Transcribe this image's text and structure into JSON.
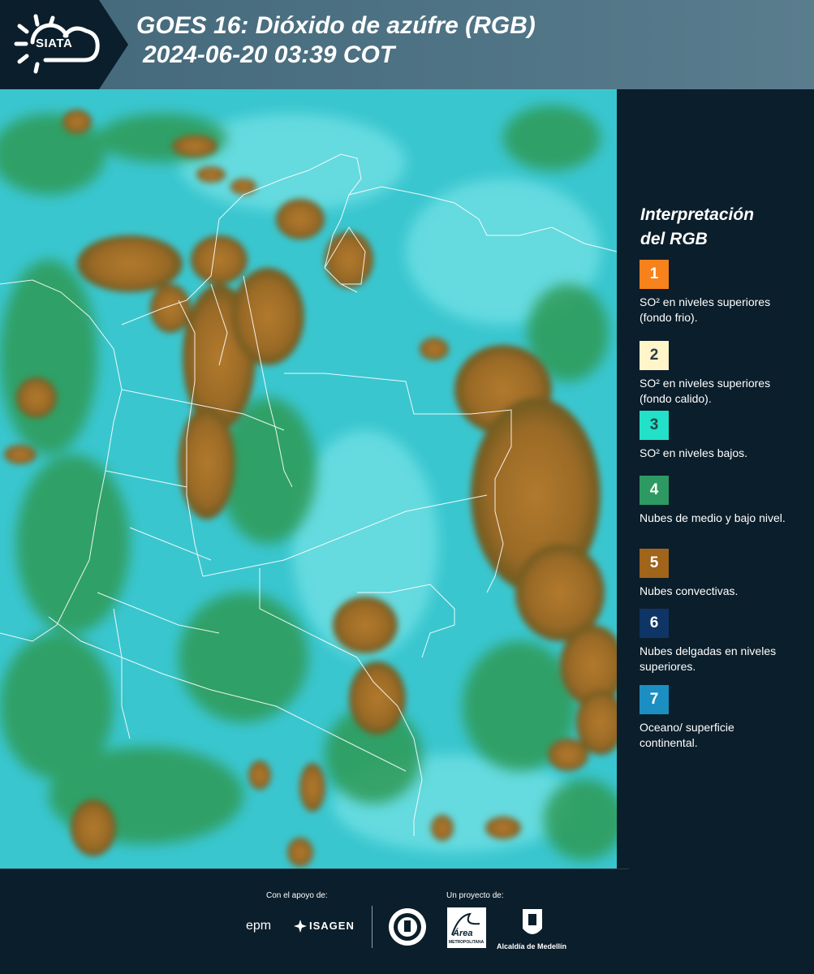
{
  "header": {
    "logo_text": "SIATA",
    "title_line1": "GOES 16: Dióxido de azúfre (RGB)",
    "title_line2": "2024-06-20 03:39 COT"
  },
  "legend": {
    "title_line1": "Interpretación",
    "title_line2": "del RGB",
    "items": [
      {
        "number": "1",
        "color": "#f7821b",
        "text_color": "#ffffff",
        "label": "SO² en niveles superiores (fondo frio)."
      },
      {
        "number": "2",
        "color": "#fff5c8",
        "text_color": "#2b3a44",
        "label": "SO² en niveles superiores (fondo calido)."
      },
      {
        "number": "3",
        "color": "#23e0c8",
        "text_color": "#1b4a45",
        "label": "SO² en niveles bajos."
      },
      {
        "number": "4",
        "color": "#2e9a63",
        "text_color": "#ffffff",
        "label": "Nubes de medio y bajo nivel."
      },
      {
        "number": "5",
        "color": "#a0641a",
        "text_color": "#ffffff",
        "label": "Nubes convectivas."
      },
      {
        "number": "6",
        "color": "#0f3566",
        "text_color": "#ffffff",
        "label": "Nubes delgadas en niveles superiores."
      },
      {
        "number": "7",
        "color": "#1c8fc2",
        "text_color": "#ffffff",
        "label": "Oceano/ superficie continental."
      }
    ]
  },
  "map": {
    "ocean_color": "#38c7cf",
    "land_green": "#2f9a55",
    "convective_color": "#a8722a",
    "border_color": "#ffffff"
  },
  "footer": {
    "support_label": "Con el apoyo de:",
    "project_label": "Un proyecto de:",
    "sponsor_epm": "epm",
    "sponsor_isagen": "ISAGEN",
    "partner_area": "Área",
    "partner_area_sub": "METROPOLITANA",
    "partner_alcaldia": "Alcaldía de Medellín"
  }
}
